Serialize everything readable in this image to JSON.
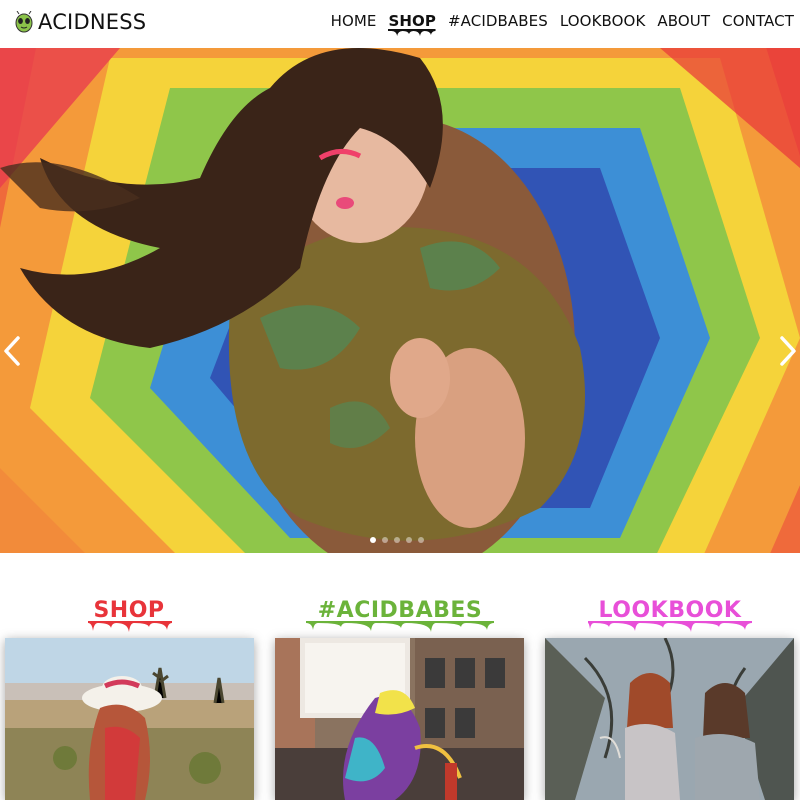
{
  "header": {
    "logo_text": "ACIDNESS",
    "nav": [
      {
        "label": "HOME"
      },
      {
        "label": "SHOP"
      },
      {
        "label": "#ACIDBABES"
      },
      {
        "label": "LOOKBOOK"
      },
      {
        "label": "ABOUT"
      },
      {
        "label": "CONTACT"
      }
    ]
  },
  "hero": {
    "prev_icon": "chevron-left-icon",
    "next_icon": "chevron-right-icon",
    "slide_count": 5,
    "active_slide": 1
  },
  "sections": [
    {
      "title": "SHOP",
      "color": "#e8343a"
    },
    {
      "title": "#ACIDBABES",
      "color": "#6bb33a"
    },
    {
      "title": "LOOKBOOK",
      "color": "#e84fd8"
    }
  ],
  "colors": {
    "accent_red": "#e8343a",
    "accent_green": "#6bb33a",
    "accent_pink": "#e84fd8"
  }
}
